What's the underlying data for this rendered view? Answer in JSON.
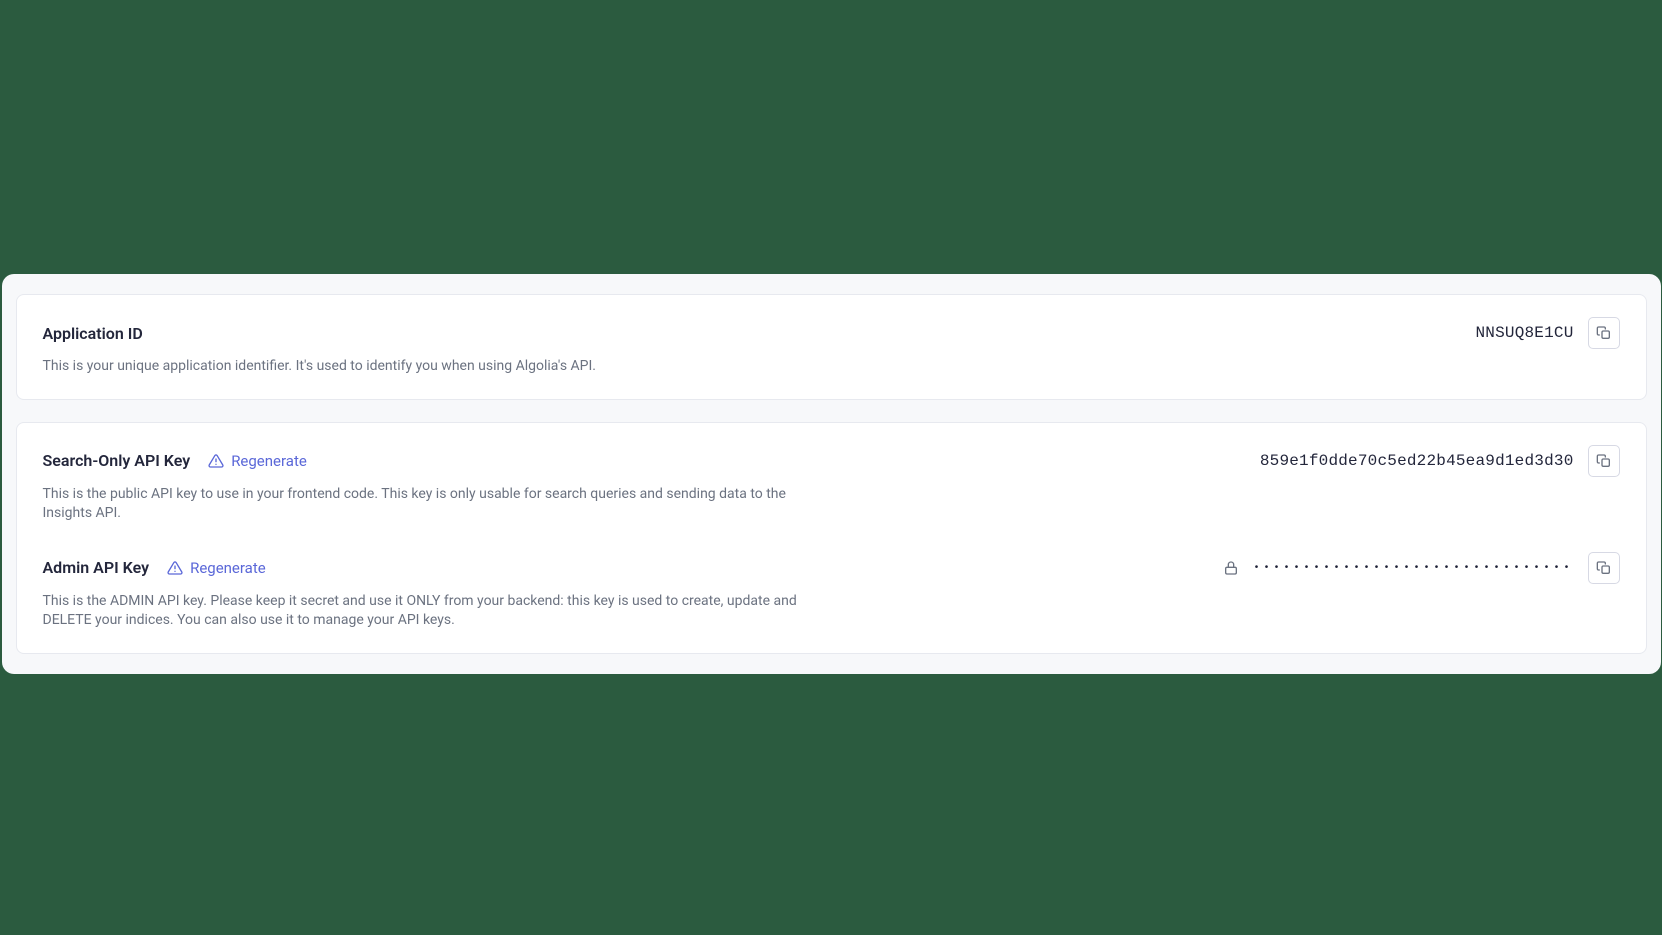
{
  "app_id_card": {
    "title": "Application ID",
    "description": "This is your unique application identifier. It's used to identify you when using Algolia's API.",
    "value": "NNSUQ8E1CU"
  },
  "keys_card": {
    "search": {
      "title": "Search-Only API Key",
      "regenerate_label": "Regenerate",
      "value": "859e1f0dde70c5ed22b45ea9d1ed3d30",
      "description": "This is the public API key to use in your frontend code. This key is only usable for search queries and sending data to the Insights API."
    },
    "admin": {
      "title": "Admin API Key",
      "regenerate_label": "Regenerate",
      "masked_value": "••••••••••••••••••••••••••••••••",
      "description": "This is the ADMIN API key. Please keep it secret and use it ONLY from your backend: this key is used to create, update and DELETE your indices. You can also use it to manage your API keys."
    }
  }
}
